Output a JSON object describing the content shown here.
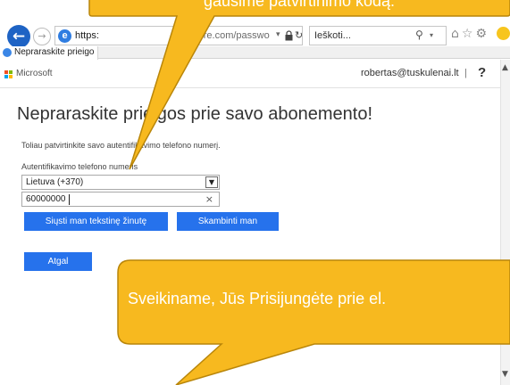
{
  "browser": {
    "address": {
      "scheme": "https:",
      "tail": "azure.com/passwo",
      "dropdown": "▾",
      "refresh": "↻"
    },
    "search": {
      "placeholder": "Ieškoti...",
      "icon": "⚲",
      "dropdown": "▾"
    },
    "tab": {
      "title": "Nepraraskite prieigo"
    },
    "toolbar_icons": "⌂☆⚙",
    "colors": {
      "back_button": "#1e63c4",
      "callout_fill": "#f7b91f",
      "callout_stroke": "#b9860a"
    }
  },
  "header": {
    "brand": "Microsoft",
    "user_email": "robertas@tuskulenai.lt",
    "separator": "|",
    "help": "?"
  },
  "main": {
    "title": "Nepraraskite prieigos prie savo abonemento!",
    "instructions": "Toliau patvirtinkite savo autentifikavimo telefono numerį.",
    "phone_label": "Autentifikavimo telefono numeris",
    "country_select": {
      "value": "Lietuva (+370)"
    },
    "phone_input": {
      "value": "60000000",
      "clear": "×"
    },
    "buttons": {
      "sms": "Siųsti man tekstinę žinutę",
      "call": "Skambinti man",
      "back": "Atgal"
    },
    "colors": {
      "button": "#2672ec"
    }
  },
  "callouts": {
    "top": "gausime patvirtinimo kodą.",
    "bottom": "Sveikiname, Jūs Prisijungėte prie el."
  }
}
